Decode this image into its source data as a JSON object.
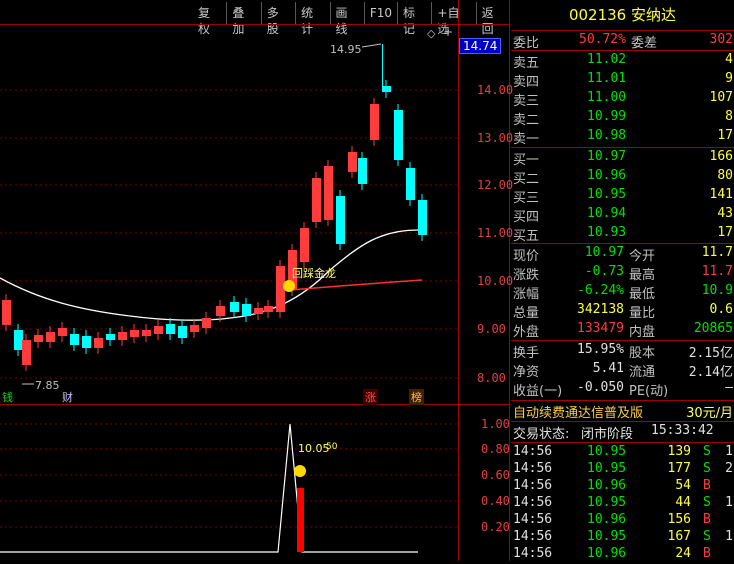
{
  "toolbar": {
    "items": [
      "复权",
      "叠加",
      "多股",
      "统计",
      "画线",
      "F10",
      "标记",
      "+自选",
      "返回"
    ]
  },
  "stock": {
    "code": "002136",
    "name": "安纳达"
  },
  "price_axis": {
    "current": "14.74",
    "ticks": [
      "14.00",
      "13.00",
      "12.00",
      "11.00",
      "10.00",
      "9.00",
      "8.00"
    ]
  },
  "volume_axis": {
    "ticks": [
      "1.00",
      "0.80",
      "0.60",
      "0.40",
      "0.20"
    ]
  },
  "annotations": {
    "high_label": "14.95",
    "low_label": "7.85",
    "signal_label": "回踩金龙",
    "signal_value": "10.05",
    "signal_suffix": "50",
    "marker_left": "钱",
    "marker_cai": "财",
    "marker_zhang": "涨",
    "marker_bang": "榜"
  },
  "header_rows": {
    "weibi_label": "委比",
    "weibi_value": "50.72%",
    "weicha_label": "委差",
    "weicha_value": "302"
  },
  "sells": [
    {
      "label": "卖五",
      "price": "11.02",
      "vol": "4"
    },
    {
      "label": "卖四",
      "price": "11.01",
      "vol": "9"
    },
    {
      "label": "卖三",
      "price": "11.00",
      "vol": "107"
    },
    {
      "label": "卖二",
      "price": "10.99",
      "vol": "8"
    },
    {
      "label": "卖一",
      "price": "10.98",
      "vol": "17"
    }
  ],
  "buys": [
    {
      "label": "买一",
      "price": "10.97",
      "vol": "166"
    },
    {
      "label": "买二",
      "price": "10.96",
      "vol": "80"
    },
    {
      "label": "买三",
      "price": "10.95",
      "vol": "141"
    },
    {
      "label": "买四",
      "price": "10.94",
      "vol": "43"
    },
    {
      "label": "买五",
      "price": "10.93",
      "vol": "17"
    }
  ],
  "quote": [
    {
      "l1": "现价",
      "v1": "10.97",
      "c1": "green",
      "l2": "今开",
      "v2": "11.7",
      "c2": "yellow"
    },
    {
      "l1": "涨跌",
      "v1": "-0.73",
      "c1": "green",
      "l2": "最高",
      "v2": "11.7",
      "c2": "red"
    },
    {
      "l1": "涨幅",
      "v1": "-6.24%",
      "c1": "green",
      "l2": "最低",
      "v2": "10.9",
      "c2": "green"
    },
    {
      "l1": "总量",
      "v1": "342138",
      "c1": "yellow",
      "l2": "量比",
      "v2": "0.6",
      "c2": "yellow"
    },
    {
      "l1": "外盘",
      "v1": "133479",
      "c1": "red",
      "l2": "内盘",
      "v2": "20865",
      "c2": "green"
    }
  ],
  "fund": [
    {
      "l1": "换手",
      "v1": "15.95%",
      "l2": "股本",
      "v2": "2.15亿"
    },
    {
      "l1": "净资",
      "v1": "5.41",
      "l2": "流通",
      "v2": "2.14亿"
    },
    {
      "l1": "收益(一)",
      "v1": "-0.050",
      "l2": "PE(动)",
      "v2": "—"
    }
  ],
  "promo": {
    "text": "自动续费通达信普及版",
    "price": "30元/月"
  },
  "trade_status": {
    "label": "交易状态:",
    "value": "闭市阶段",
    "time": "15:33:42"
  },
  "ticks": [
    {
      "time": "14:56",
      "price": "10.95",
      "vol": "139",
      "side": "S",
      "n": "1"
    },
    {
      "time": "14:56",
      "price": "10.95",
      "vol": "177",
      "side": "S",
      "n": "2"
    },
    {
      "time": "14:56",
      "price": "10.96",
      "vol": "54",
      "side": "B",
      "n": ""
    },
    {
      "time": "14:56",
      "price": "10.95",
      "vol": "44",
      "side": "S",
      "n": "1"
    },
    {
      "time": "14:56",
      "price": "10.96",
      "vol": "156",
      "side": "B",
      "n": ""
    },
    {
      "time": "14:56",
      "price": "10.95",
      "vol": "167",
      "side": "S",
      "n": "1"
    },
    {
      "time": "14:56",
      "price": "10.96",
      "vol": "24",
      "side": "B",
      "n": ""
    }
  ],
  "colors": {
    "up": "#ff3c3c",
    "down": "#00ffff",
    "ma": "#ffffff",
    "ma2": "#ff3c3c",
    "axis": "#a00000"
  }
}
